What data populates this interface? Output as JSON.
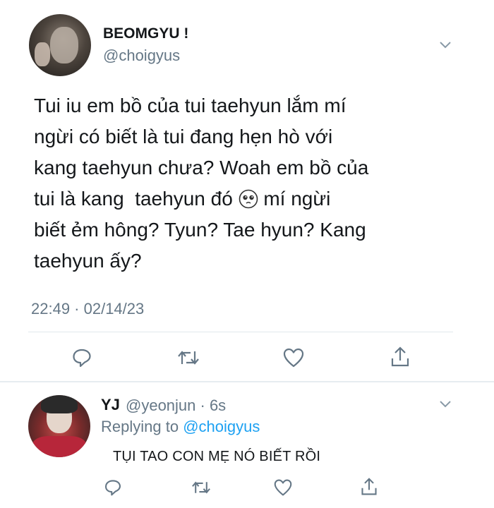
{
  "tweet": {
    "author_name": "BEOMGYU !",
    "author_handle": "@choigyus",
    "lines": [
      "Tui iu em bồ của tui taehyun lắm mí",
      "ngừi có biết là tui đang hẹn hò với",
      "kang taehyun chưa? Woah em bồ của",
      "tui là kang  taehyun đó",
      " mí ngừi",
      "biết ẻm hông? Tyun? Tae hyun? Kang",
      "taehyun ấy?"
    ],
    "timestamp": "22:49 · 02/14/23",
    "emoji": "pleading-face-icon"
  },
  "reply": {
    "author_name": "YJ",
    "author_handle": "@yeonjun · 6s",
    "replying_prefix": "Replying to ",
    "replying_to": "@choigyus",
    "text": "TỤI TAO CON MẸ NÓ BIẾT RỒI"
  },
  "icons": {
    "reply": "reply-icon",
    "retweet": "retweet-icon",
    "like": "like-icon",
    "share": "share-icon",
    "menu": "chevron-down-icon"
  },
  "colors": {
    "text": "#14171a",
    "secondary": "#657786",
    "link": "#1da1f2",
    "divider": "#e1e8ed"
  }
}
